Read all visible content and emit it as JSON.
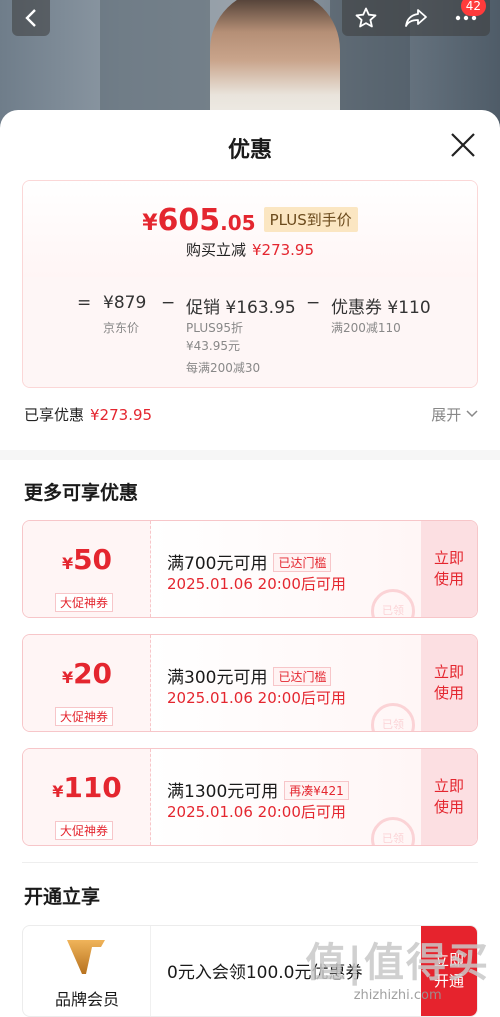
{
  "header": {
    "notification_count": "42",
    "icons": [
      "back-icon",
      "star-icon",
      "share-icon",
      "more-icon"
    ]
  },
  "sheet": {
    "title": "优惠"
  },
  "price": {
    "yen": "¥",
    "integer": "605",
    "decimal": ".05",
    "plus_tag": "PLUS到手价",
    "reduce_label": "购买立减",
    "reduce_value": "¥273.95"
  },
  "formula": {
    "eq": "=",
    "base": "¥879",
    "base_label": "京东价",
    "minus1": "−",
    "promo": "促销 ¥163.95",
    "promo_sub1": "PLUS95折",
    "promo_sub2": "¥43.95元",
    "promo_sub3": "每满200减30",
    "minus2": "−",
    "coupon": "优惠券 ¥110",
    "coupon_sub": "满200减110"
  },
  "enjoyed": {
    "label": "已享优惠",
    "value": "¥273.95",
    "expand": "展开"
  },
  "more_section": {
    "title": "更多可享优惠"
  },
  "coupons": [
    {
      "yen": "¥",
      "amount": "50",
      "type": "大促神券",
      "condition": "满700元可用",
      "tag": "已达门槛",
      "time": "2025.01.06 20:00后可用",
      "stamp": "已领",
      "action": "立即使用"
    },
    {
      "yen": "¥",
      "amount": "20",
      "type": "大促神券",
      "condition": "满300元可用",
      "tag": "已达门槛",
      "time": "2025.01.06 20:00后可用",
      "stamp": "已领",
      "action": "立即使用"
    },
    {
      "yen": "¥",
      "amount": "110",
      "type": "大促神券",
      "condition": "满1300元可用",
      "tag": "再凑¥421",
      "time": "2025.01.06 20:00后可用",
      "stamp": "已领",
      "action": "立即使用"
    }
  ],
  "member_section": {
    "title": "开通立享"
  },
  "member": {
    "name": "品牌会员",
    "text": "0元入会领100.0元优惠券",
    "action": "立即开通"
  },
  "watermark": {
    "big": "值|值得买",
    "url": "zhizhizhi.com"
  },
  "colors": {
    "accent": "#e4262f",
    "pink_border": "#f7c6c9",
    "plus_gold": "#fbe6c2"
  }
}
